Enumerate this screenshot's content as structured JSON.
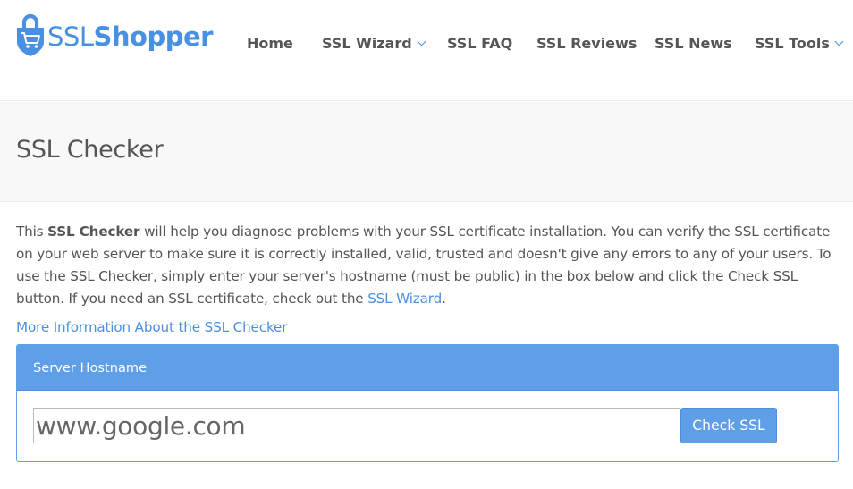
{
  "brand": {
    "ssl": "SSL",
    "shopper": "Shopper",
    "color": "#4a90e2"
  },
  "nav": {
    "items": [
      {
        "label": "Home",
        "has_dropdown": false
      },
      {
        "label": "SSL Wizard",
        "has_dropdown": true
      },
      {
        "label": "SSL FAQ",
        "has_dropdown": false
      },
      {
        "label": "SSL Reviews",
        "has_dropdown": false
      },
      {
        "label": "SSL News",
        "has_dropdown": false
      },
      {
        "label": "SSL Tools",
        "has_dropdown": true
      }
    ]
  },
  "page": {
    "title": "SSL Checker"
  },
  "intro": {
    "prefix": "This ",
    "bold": "SSL Checker",
    "body": " will help you diagnose problems with your SSL certificate installation. You can verify the SSL certificate on your web server to make sure it is correctly installed, valid, trusted and doesn't give any errors to any of your users. To use the SSL Checker, simply enter your server's hostname (must be public) in the box below and click the Check SSL button. If you need an SSL certificate, check out the ",
    "link": "SSL Wizard",
    "suffix": "."
  },
  "more_info_link": "More Information About the SSL Checker",
  "panel": {
    "heading": "Server Hostname",
    "input_value": "www.google.com",
    "button_label": "Check SSL",
    "accent": "#5e9fe8"
  }
}
